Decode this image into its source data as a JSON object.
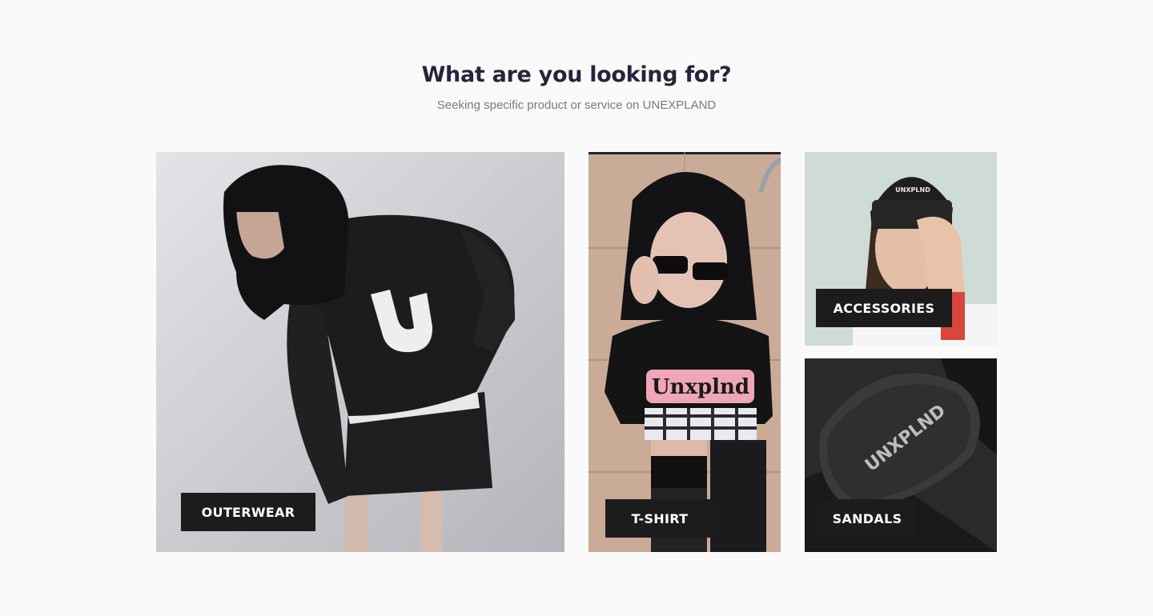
{
  "section": {
    "title": "What are you looking for?",
    "subtitle": "Seeking specific product or service on UNEXPLAND"
  },
  "categories": [
    {
      "label": "OUTERWEAR"
    },
    {
      "label": "T-SHIRT",
      "shirt_print": "Unxplnd"
    },
    {
      "label": "ACCESSORIES",
      "beanie_print": "UNXPLND"
    },
    {
      "label": "SANDALS",
      "strap_print": "UNXPLND"
    }
  ],
  "colors": {
    "background": "#fafafa",
    "heading": "#23263a",
    "subtitle": "#7a7a7a",
    "label_bg": "#1d1c1d",
    "label_text": "#ffffff"
  }
}
